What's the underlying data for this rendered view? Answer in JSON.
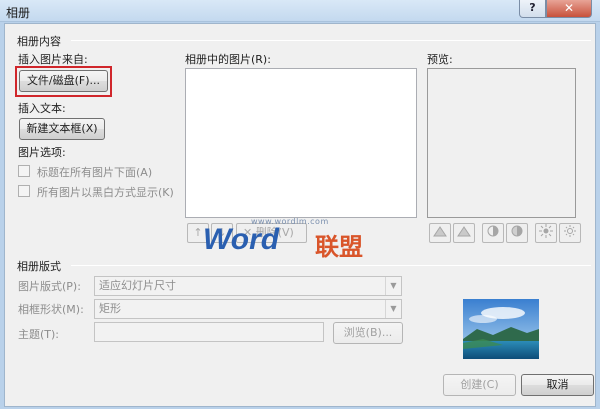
{
  "window": {
    "title": "相册",
    "help_label": "?",
    "close_label": "✕"
  },
  "album_content": {
    "group_title": "相册内容",
    "insert_from_label": "插入图片来自:",
    "file_disk_button": "文件/磁盘(F)...",
    "insert_text_label": "插入文本:",
    "new_textbox_button": "新建文本框(X)",
    "picture_options_label": "图片选项:",
    "option_captions": "标题在所有图片下面(A)",
    "option_bw": "所有图片以黑白方式显示(K)",
    "pictures_in_album_label": "相册中的图片(R):",
    "preview_label": "预览:",
    "move_up_icon": "↑",
    "move_down_icon": "↓",
    "remove_button": "删除(V)",
    "remove_icon": "✕"
  },
  "album_layout": {
    "group_title": "相册版式",
    "picture_layout_label": "图片版式(P):",
    "picture_layout_value": "适应幻灯片尺寸",
    "frame_shape_label": "相框形状(M):",
    "frame_shape_value": "矩形",
    "theme_label": "主题(T):",
    "browse_button": "浏览(B)...",
    "combo_arrow": "▼"
  },
  "footer": {
    "create_button": "创建(C)",
    "cancel_button": "取消"
  },
  "watermark": {
    "url": "www.wordlm.com",
    "word": "Word",
    "cn": "联盟"
  },
  "colors": {
    "highlight": "#d0262b",
    "disabled_text": "#8d8d8d"
  }
}
